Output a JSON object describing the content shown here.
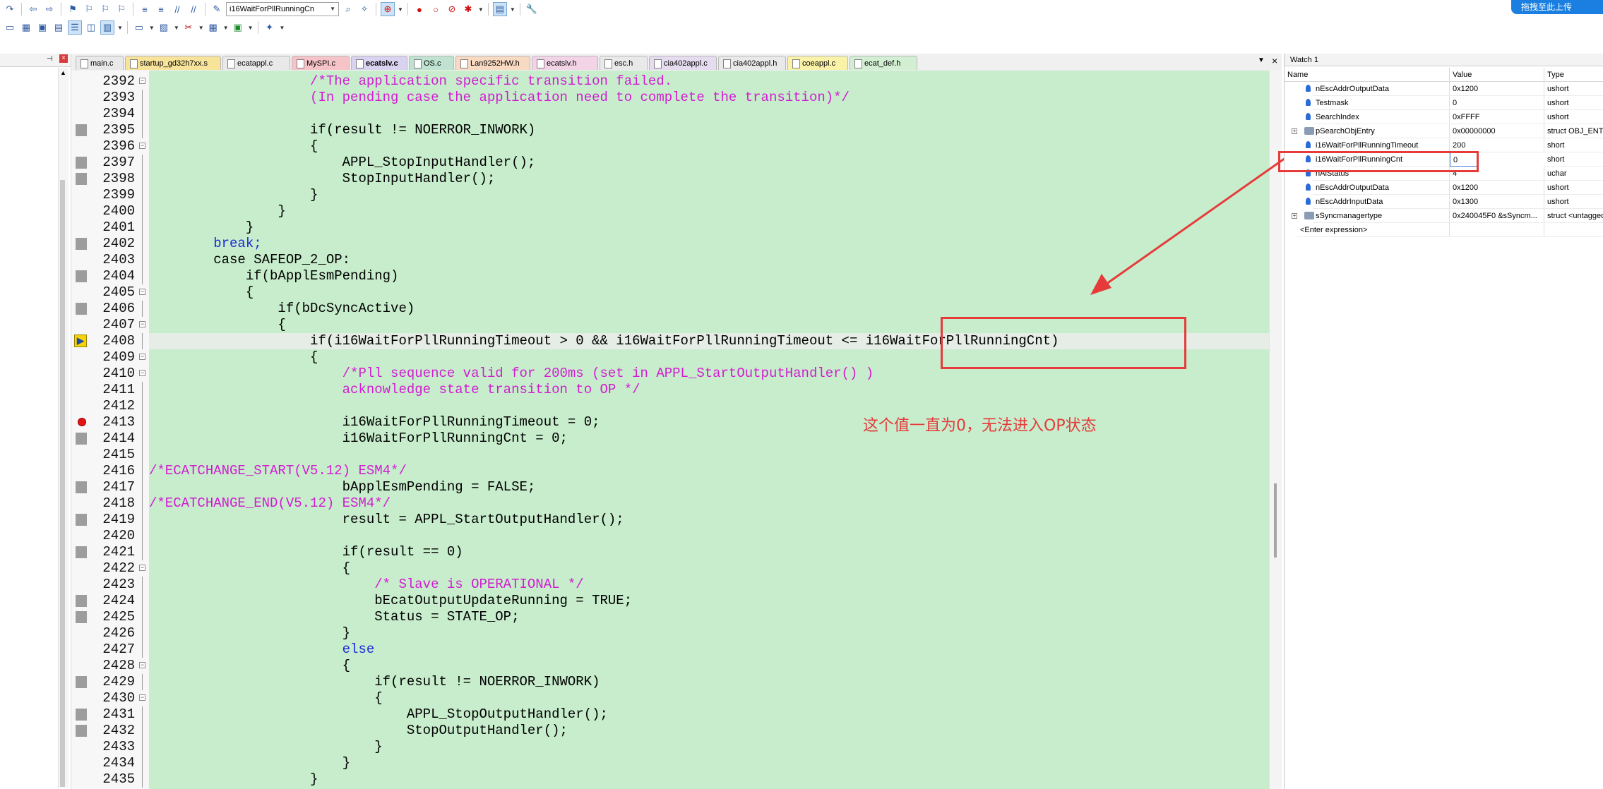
{
  "toolbar": {
    "combo_value": "i16WaitForPllRunningCn",
    "upload_badge": "拖拽至此上传"
  },
  "tabs": [
    {
      "label": "main.c",
      "color": "#e9e9e9"
    },
    {
      "label": "startup_gd32h7xx.s",
      "color": "#f7e39a"
    },
    {
      "label": "ecatappl.c",
      "color": "#e9e9e9"
    },
    {
      "label": "MySPI.c",
      "color": "#f6c3c8"
    },
    {
      "label": "ecatslv.c",
      "color": "#d9d2f0"
    },
    {
      "label": "OS.c",
      "color": "#bfe3d0"
    },
    {
      "label": "Lan9252HW.h",
      "color": "#f8d9c2"
    },
    {
      "label": "ecatslv.h",
      "color": "#f3d4e6"
    },
    {
      "label": "esc.h",
      "color": "#e9e9e9"
    },
    {
      "label": "cia402appl.c",
      "color": "#e5dcef"
    },
    {
      "label": "cia402appl.h",
      "color": "#e9e9e9"
    },
    {
      "label": "coeappl.c",
      "color": "#f9f2a8"
    },
    {
      "label": "ecat_def.h",
      "color": "#d3efd3"
    }
  ],
  "code_lines": [
    {
      "num": "2392",
      "text": "                    /*The application specific transition failed.",
      "cls": "c-cmt",
      "fold": "minus"
    },
    {
      "num": "2393",
      "text": "                    (In pending case the application need to complete the transition)*/",
      "cls": "c-cmt",
      "fold": "line"
    },
    {
      "num": "2394",
      "text": "",
      "cls": "",
      "fold": "line"
    },
    {
      "num": "2395",
      "text": "                    if(result != NOERROR_INWORK)",
      "cls": "",
      "fold": "line",
      "mark": "grey"
    },
    {
      "num": "2396",
      "text": "                    {",
      "cls": "",
      "fold": "minus"
    },
    {
      "num": "2397",
      "text": "                        APPL_StopInputHandler();",
      "cls": "",
      "fold": "line",
      "mark": "grey"
    },
    {
      "num": "2398",
      "text": "                        StopInputHandler();",
      "cls": "",
      "fold": "line",
      "mark": "grey"
    },
    {
      "num": "2399",
      "text": "                    }",
      "cls": "",
      "fold": "line"
    },
    {
      "num": "2400",
      "text": "                }",
      "cls": "",
      "fold": "line"
    },
    {
      "num": "2401",
      "text": "            }",
      "cls": "",
      "fold": "line"
    },
    {
      "num": "2402",
      "text": "        break;",
      "cls": "c-kw",
      "fold": "line",
      "mark": "grey"
    },
    {
      "num": "2403",
      "text": "        case SAFEOP_2_OP:",
      "cls": "",
      "fold": "line"
    },
    {
      "num": "2404",
      "text": "            if(bApplEsmPending)",
      "cls": "",
      "fold": "line",
      "mark": "grey"
    },
    {
      "num": "2405",
      "text": "            {",
      "cls": "",
      "fold": "minus"
    },
    {
      "num": "2406",
      "text": "                if(bDcSyncActive)",
      "cls": "",
      "fold": "line",
      "mark": "grey"
    },
    {
      "num": "2407",
      "text": "                {",
      "cls": "",
      "fold": "minus"
    },
    {
      "num": "2408",
      "text": "                    if(i16WaitForPllRunningTimeout > 0 && i16WaitForPllRunningTimeout <= i16WaitForPllRunningCnt)",
      "cls": "",
      "fold": "line",
      "mark": "pc",
      "current": true
    },
    {
      "num": "2409",
      "text": "                    {",
      "cls": "",
      "fold": "minus"
    },
    {
      "num": "2410",
      "text": "                        /*Pll sequence valid for 200ms (set in APPL_StartOutputHandler() )",
      "cls": "c-cmt",
      "fold": "minus"
    },
    {
      "num": "2411",
      "text": "                        acknowledge state transition to OP */",
      "cls": "c-cmt",
      "fold": "line"
    },
    {
      "num": "2412",
      "text": "",
      "cls": "",
      "fold": "line"
    },
    {
      "num": "2413",
      "text": "                        i16WaitForPllRunningTimeout = 0;",
      "cls": "",
      "fold": "line",
      "mark": "bp"
    },
    {
      "num": "2414",
      "text": "                        i16WaitForPllRunningCnt = 0;",
      "cls": "",
      "fold": "line",
      "mark": "grey"
    },
    {
      "num": "2415",
      "text": "",
      "cls": "",
      "fold": "line"
    },
    {
      "num": "2416",
      "text": "/*ECATCHANGE_START(V5.12) ESM4*/",
      "cls": "c-cmt",
      "fold": "line"
    },
    {
      "num": "2417",
      "text": "                        bApplEsmPending = FALSE;",
      "cls": "",
      "fold": "line",
      "mark": "grey"
    },
    {
      "num": "2418",
      "text": "/*ECATCHANGE_END(V5.12) ESM4*/",
      "cls": "c-cmt",
      "fold": "line"
    },
    {
      "num": "2419",
      "text": "                        result = APPL_StartOutputHandler();",
      "cls": "",
      "fold": "line",
      "mark": "grey"
    },
    {
      "num": "2420",
      "text": "",
      "cls": "",
      "fold": "line"
    },
    {
      "num": "2421",
      "text": "                        if(result == 0)",
      "cls": "",
      "fold": "line",
      "mark": "grey"
    },
    {
      "num": "2422",
      "text": "                        {",
      "cls": "",
      "fold": "minus"
    },
    {
      "num": "2423",
      "text": "                            /* Slave is OPERATIONAL */",
      "cls": "c-cmt",
      "fold": "line"
    },
    {
      "num": "2424",
      "text": "                            bEcatOutputUpdateRunning = TRUE;",
      "cls": "",
      "fold": "line",
      "mark": "grey"
    },
    {
      "num": "2425",
      "text": "                            Status = STATE_OP;",
      "cls": "",
      "fold": "line",
      "mark": "grey"
    },
    {
      "num": "2426",
      "text": "                        }",
      "cls": "",
      "fold": "line"
    },
    {
      "num": "2427",
      "text": "                        else",
      "cls": "c-kw",
      "fold": "line"
    },
    {
      "num": "2428",
      "text": "                        {",
      "cls": "",
      "fold": "minus"
    },
    {
      "num": "2429",
      "text": "                            if(result != NOERROR_INWORK)",
      "cls": "",
      "fold": "line",
      "mark": "grey"
    },
    {
      "num": "2430",
      "text": "                            {",
      "cls": "",
      "fold": "minus"
    },
    {
      "num": "2431",
      "text": "                                APPL_StopOutputHandler();",
      "cls": "",
      "fold": "line",
      "mark": "grey"
    },
    {
      "num": "2432",
      "text": "                                StopOutputHandler();",
      "cls": "",
      "fold": "line",
      "mark": "grey"
    },
    {
      "num": "2433",
      "text": "                            }",
      "cls": "",
      "fold": "line"
    },
    {
      "num": "2434",
      "text": "                        }",
      "cls": "",
      "fold": "line"
    },
    {
      "num": "2435",
      "text": "                    }",
      "cls": "",
      "fold": "line"
    }
  ],
  "annotation": {
    "text": "这个值一直为0，无法进入OP状态",
    "color": "#e53b3b"
  },
  "watch": {
    "title": "Watch 1",
    "columns": [
      "Name",
      "Value",
      "Type"
    ],
    "rows": [
      {
        "name": "nEscAddrOutputData",
        "value": "0x1200",
        "type": "ushort",
        "icon": "blue"
      },
      {
        "name": "Testmask",
        "value": "0",
        "type": "ushort",
        "icon": "blue"
      },
      {
        "name": "SearchIndex",
        "value": "0xFFFF",
        "type": "ushort",
        "icon": "blue"
      },
      {
        "name": "pSearchObjEntry",
        "value": "0x00000000",
        "type": "struct OBJ_ENTRY *",
        "icon": "struct",
        "expand": true
      },
      {
        "name": "i16WaitForPllRunningTimeout",
        "value": "200",
        "type": "short",
        "icon": "blue"
      },
      {
        "name": "i16WaitForPllRunningCnt",
        "value": "0",
        "type": "short",
        "icon": "blue",
        "editing": true
      },
      {
        "name": "nAlStatus",
        "value": "4",
        "type": "uchar",
        "icon": "blue"
      },
      {
        "name": "nEscAddrOutputData",
        "value": "0x1200",
        "type": "ushort",
        "icon": "blue"
      },
      {
        "name": "nEscAddrInputData",
        "value": "0x1300",
        "type": "ushort",
        "icon": "blue"
      },
      {
        "name": "sSyncmanagertype",
        "value": "0x240045F0 &sSyncm...",
        "type": "struct <untagged> *",
        "icon": "struct",
        "expand": true
      },
      {
        "name": "<Enter expression>",
        "value": "",
        "type": "",
        "icon": "none"
      }
    ]
  },
  "colors": {
    "code_bg": "#c7edcc",
    "comment": "#d21cd2",
    "keyword": "#1c2bd6",
    "annotation": "#e53b3b"
  }
}
